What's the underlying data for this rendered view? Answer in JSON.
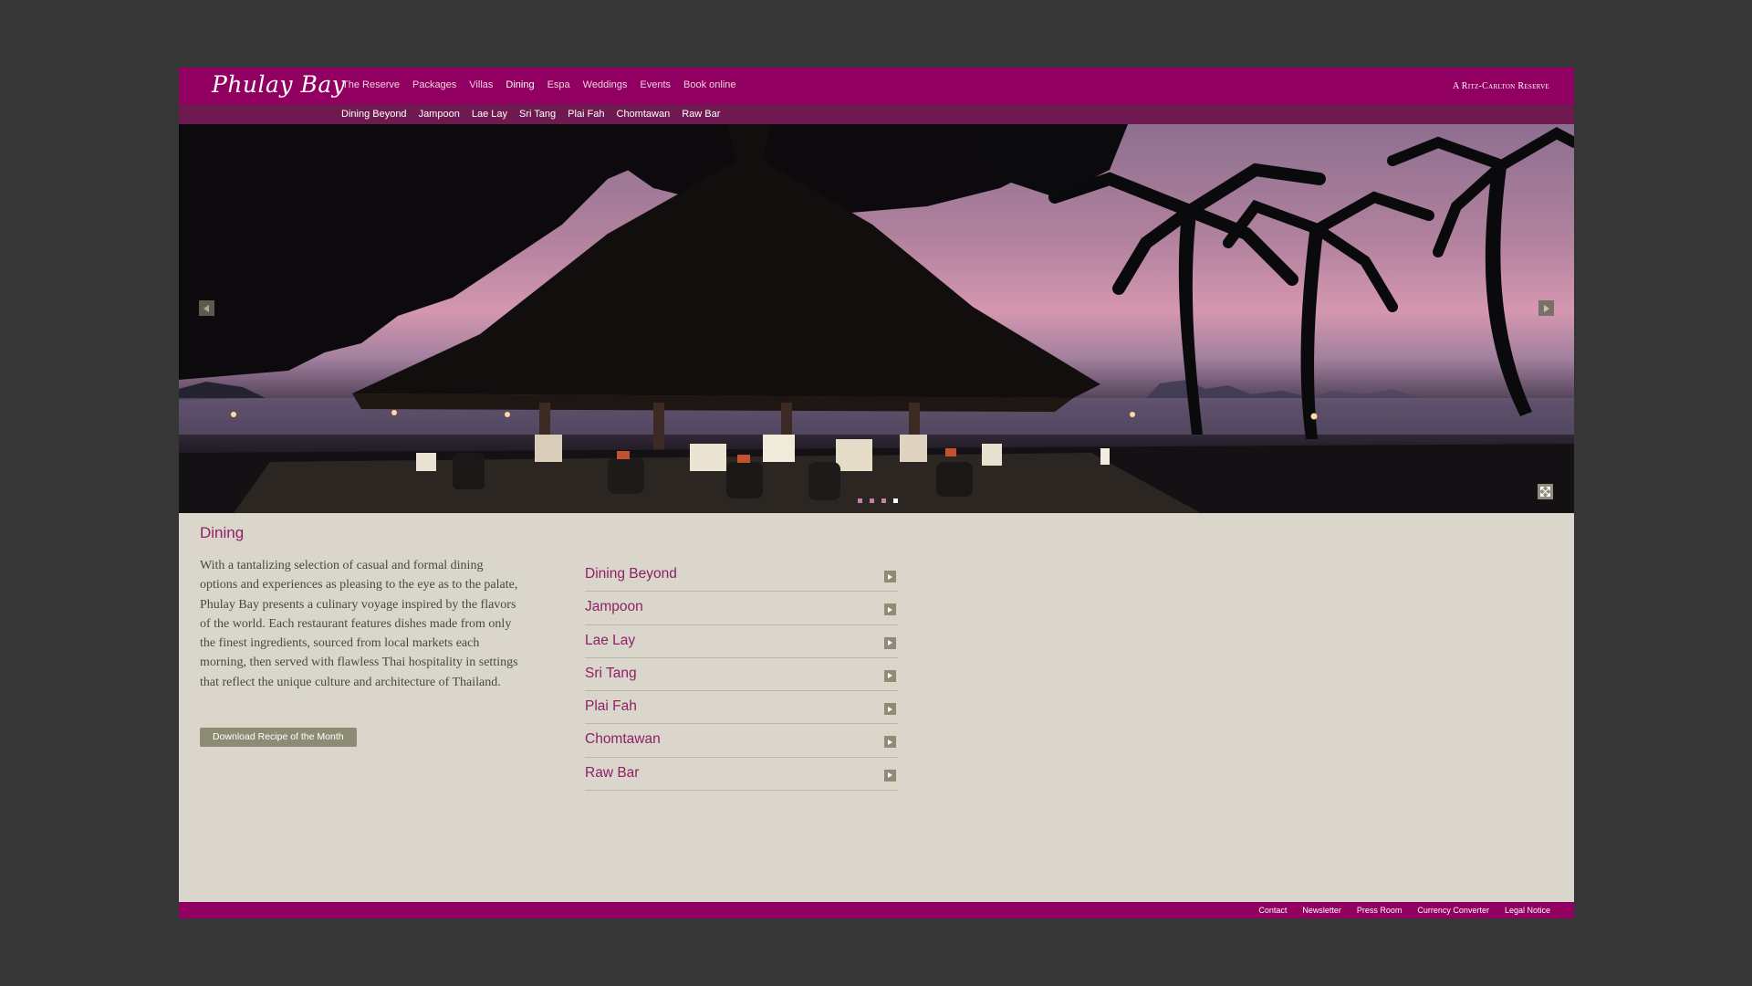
{
  "header": {
    "logo_text": "Phulay Bay",
    "brand_right": "A Ritz-Carlton Reserve",
    "main_nav": [
      {
        "label": "The Reserve",
        "active": false
      },
      {
        "label": "Packages",
        "active": false
      },
      {
        "label": "Villas",
        "active": false
      },
      {
        "label": "Dining",
        "active": true
      },
      {
        "label": "Espa",
        "active": false
      },
      {
        "label": "Weddings",
        "active": false
      },
      {
        "label": "Events",
        "active": false
      },
      {
        "label": "Book online",
        "active": false
      }
    ],
    "sub_nav": [
      "Dining Beyond",
      "Jampoon",
      "Lae Lay",
      "Sri Tang",
      "Plai Fah",
      "Chomtawan",
      "Raw Bar"
    ]
  },
  "hero": {
    "slide_count": 4,
    "active_slide": 4
  },
  "content": {
    "title": "Dining",
    "intro": "With a tantalizing selection of casual and formal dining options and experiences as pleasing to the eye as to the palate, Phulay Bay presents a culinary voyage inspired by the flavors of the world. Each restaurant features dishes made from only the finest ingredients, sourced from local markets each morning, then served with flawless Thai hospitality in settings that reflect the unique culture and architecture of Thailand.",
    "download_label": "Download Recipe of the Month",
    "restaurants": [
      "Dining Beyond",
      "Jampoon",
      "Lae Lay",
      "Sri Tang",
      "Plai Fah",
      "Chomtawan",
      "Raw Bar"
    ]
  },
  "footer": {
    "links": [
      "Contact",
      "Newsletter",
      "Press Room",
      "Currency Converter",
      "Legal Notice"
    ]
  },
  "colors": {
    "background": "#363636",
    "brand": "#910060",
    "sub_bar": "#6e1a50",
    "content_bg": "#dad6cc",
    "accent_text": "#8f1f66",
    "button": "#8e8b74"
  }
}
